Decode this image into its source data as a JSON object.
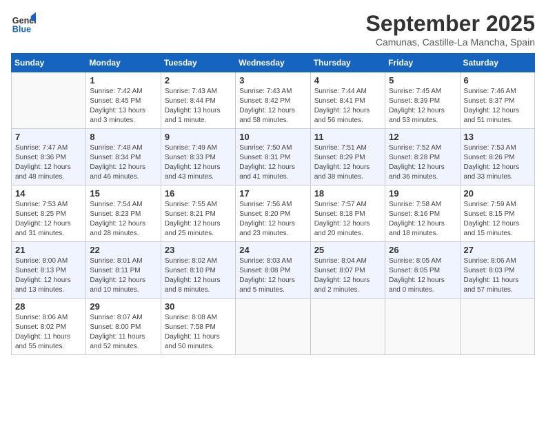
{
  "logo": {
    "text_general": "General",
    "text_blue": "Blue"
  },
  "header": {
    "title": "September 2025",
    "subtitle": "Camunas, Castille-La Mancha, Spain"
  },
  "weekdays": [
    "Sunday",
    "Monday",
    "Tuesday",
    "Wednesday",
    "Thursday",
    "Friday",
    "Saturday"
  ],
  "weeks": [
    [
      {
        "day": "",
        "info": ""
      },
      {
        "day": "1",
        "info": "Sunrise: 7:42 AM\nSunset: 8:45 PM\nDaylight: 13 hours\nand 3 minutes."
      },
      {
        "day": "2",
        "info": "Sunrise: 7:43 AM\nSunset: 8:44 PM\nDaylight: 13 hours\nand 1 minute."
      },
      {
        "day": "3",
        "info": "Sunrise: 7:43 AM\nSunset: 8:42 PM\nDaylight: 12 hours\nand 58 minutes."
      },
      {
        "day": "4",
        "info": "Sunrise: 7:44 AM\nSunset: 8:41 PM\nDaylight: 12 hours\nand 56 minutes."
      },
      {
        "day": "5",
        "info": "Sunrise: 7:45 AM\nSunset: 8:39 PM\nDaylight: 12 hours\nand 53 minutes."
      },
      {
        "day": "6",
        "info": "Sunrise: 7:46 AM\nSunset: 8:37 PM\nDaylight: 12 hours\nand 51 minutes."
      }
    ],
    [
      {
        "day": "7",
        "info": "Sunrise: 7:47 AM\nSunset: 8:36 PM\nDaylight: 12 hours\nand 48 minutes."
      },
      {
        "day": "8",
        "info": "Sunrise: 7:48 AM\nSunset: 8:34 PM\nDaylight: 12 hours\nand 46 minutes."
      },
      {
        "day": "9",
        "info": "Sunrise: 7:49 AM\nSunset: 8:33 PM\nDaylight: 12 hours\nand 43 minutes."
      },
      {
        "day": "10",
        "info": "Sunrise: 7:50 AM\nSunset: 8:31 PM\nDaylight: 12 hours\nand 41 minutes."
      },
      {
        "day": "11",
        "info": "Sunrise: 7:51 AM\nSunset: 8:29 PM\nDaylight: 12 hours\nand 38 minutes."
      },
      {
        "day": "12",
        "info": "Sunrise: 7:52 AM\nSunset: 8:28 PM\nDaylight: 12 hours\nand 36 minutes."
      },
      {
        "day": "13",
        "info": "Sunrise: 7:53 AM\nSunset: 8:26 PM\nDaylight: 12 hours\nand 33 minutes."
      }
    ],
    [
      {
        "day": "14",
        "info": "Sunrise: 7:53 AM\nSunset: 8:25 PM\nDaylight: 12 hours\nand 31 minutes."
      },
      {
        "day": "15",
        "info": "Sunrise: 7:54 AM\nSunset: 8:23 PM\nDaylight: 12 hours\nand 28 minutes."
      },
      {
        "day": "16",
        "info": "Sunrise: 7:55 AM\nSunset: 8:21 PM\nDaylight: 12 hours\nand 25 minutes."
      },
      {
        "day": "17",
        "info": "Sunrise: 7:56 AM\nSunset: 8:20 PM\nDaylight: 12 hours\nand 23 minutes."
      },
      {
        "day": "18",
        "info": "Sunrise: 7:57 AM\nSunset: 8:18 PM\nDaylight: 12 hours\nand 20 minutes."
      },
      {
        "day": "19",
        "info": "Sunrise: 7:58 AM\nSunset: 8:16 PM\nDaylight: 12 hours\nand 18 minutes."
      },
      {
        "day": "20",
        "info": "Sunrise: 7:59 AM\nSunset: 8:15 PM\nDaylight: 12 hours\nand 15 minutes."
      }
    ],
    [
      {
        "day": "21",
        "info": "Sunrise: 8:00 AM\nSunset: 8:13 PM\nDaylight: 12 hours\nand 13 minutes."
      },
      {
        "day": "22",
        "info": "Sunrise: 8:01 AM\nSunset: 8:11 PM\nDaylight: 12 hours\nand 10 minutes."
      },
      {
        "day": "23",
        "info": "Sunrise: 8:02 AM\nSunset: 8:10 PM\nDaylight: 12 hours\nand 8 minutes."
      },
      {
        "day": "24",
        "info": "Sunrise: 8:03 AM\nSunset: 8:08 PM\nDaylight: 12 hours\nand 5 minutes."
      },
      {
        "day": "25",
        "info": "Sunrise: 8:04 AM\nSunset: 8:07 PM\nDaylight: 12 hours\nand 2 minutes."
      },
      {
        "day": "26",
        "info": "Sunrise: 8:05 AM\nSunset: 8:05 PM\nDaylight: 12 hours\nand 0 minutes."
      },
      {
        "day": "27",
        "info": "Sunrise: 8:06 AM\nSunset: 8:03 PM\nDaylight: 11 hours\nand 57 minutes."
      }
    ],
    [
      {
        "day": "28",
        "info": "Sunrise: 8:06 AM\nSunset: 8:02 PM\nDaylight: 11 hours\nand 55 minutes."
      },
      {
        "day": "29",
        "info": "Sunrise: 8:07 AM\nSunset: 8:00 PM\nDaylight: 11 hours\nand 52 minutes."
      },
      {
        "day": "30",
        "info": "Sunrise: 8:08 AM\nSunset: 7:58 PM\nDaylight: 11 hours\nand 50 minutes."
      },
      {
        "day": "",
        "info": ""
      },
      {
        "day": "",
        "info": ""
      },
      {
        "day": "",
        "info": ""
      },
      {
        "day": "",
        "info": ""
      }
    ]
  ]
}
